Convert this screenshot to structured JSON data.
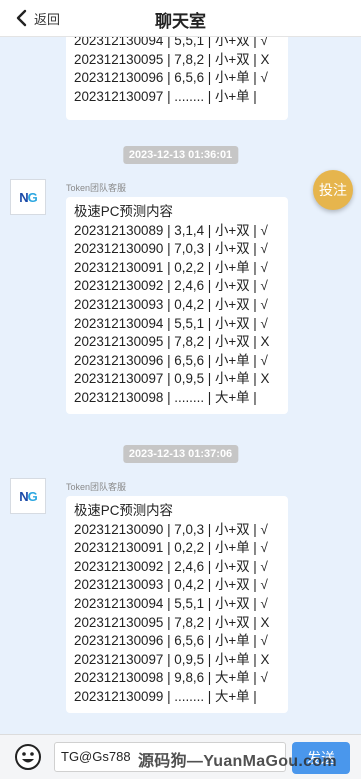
{
  "header": {
    "back_label": "返回",
    "title": "聊天室"
  },
  "partial_lines": [
    "202312130094 | 5,5,1 | 小+双 | √",
    "202312130095 | 7,8,2 | 小+双 | X",
    "202312130096 | 6,5,6 | 小+单 | √",
    "202312130097 | ........ | 小+单 |"
  ],
  "fab_label": "投注",
  "messages": [
    {
      "time": "2023-12-13 01:36:01",
      "sender": "Token团队客服",
      "lines": [
        "极速PC预测内容",
        "202312130089 | 3,1,4 | 小+双 | √",
        "202312130090 | 7,0,3 | 小+双 | √",
        "202312130091 | 0,2,2 | 小+单 | √",
        "202312130092 | 2,4,6 | 小+双 | √",
        "202312130093 | 0,4,2 | 小+双 | √",
        "202312130094 | 5,5,1 | 小+双 | √",
        "202312130095 | 7,8,2 | 小+双 | X",
        "202312130096 | 6,5,6 | 小+单 | √",
        "202312130097 | 0,9,5 | 小+单 | X",
        "202312130098 | ........ | 大+单 |"
      ]
    },
    {
      "time": "2023-12-13 01:37:06",
      "sender": "Token团队客服",
      "lines": [
        "极速PC预测内容",
        "202312130090 | 7,0,3 | 小+双 | √",
        "202312130091 | 0,2,2 | 小+单 | √",
        "202312130092 | 2,4,6 | 小+双 | √",
        "202312130093 | 0,4,2 | 小+双 | √",
        "202312130094 | 5,5,1 | 小+双 | √",
        "202312130095 | 7,8,2 | 小+双 | X",
        "202312130096 | 6,5,6 | 小+单 | √",
        "202312130097 | 0,9,5 | 小+单 | X",
        "202312130098 | 9,8,6 | 大+单 | √",
        "202312130099 | ........ | 大+单 |"
      ]
    }
  ],
  "input": {
    "value": "TG@Gs788"
  },
  "send_label": "发送",
  "watermark": "源码狗—YuanMaGou.com"
}
